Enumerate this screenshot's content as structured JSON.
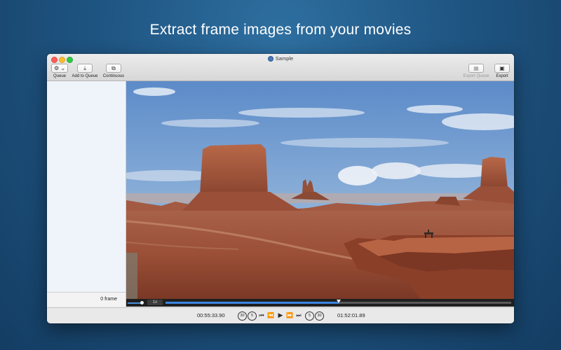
{
  "headline": "Extract frame images from your movies",
  "window": {
    "title": "Sample"
  },
  "toolbar": {
    "queue_icon": "⚙ ⌄",
    "queue_label": "Queue",
    "add_icon": "⤓",
    "add_label": "Add to Queue",
    "continuous_icon": "⧉",
    "continuous_label": "Continuous",
    "export_queue_icon": "▦",
    "export_queue_label": "Export Queue",
    "export_icon": "▣",
    "export_label": "Export"
  },
  "sidebar": {
    "frame_count": "0 frame"
  },
  "player": {
    "speed": "1x",
    "progress": 0.5,
    "current_time": "00:55:33.90",
    "total_time": "01:52:01.89",
    "back30": "30",
    "back5": "5",
    "fwd5": "5",
    "fwd30": "30",
    "prev_glyph": "⏮",
    "rewind_glyph": "⏪",
    "play_glyph": "▶",
    "forward_glyph": "⏩",
    "next_glyph": "⏭"
  },
  "colors": {
    "accent": "#3a86e0",
    "background": "#1f5582"
  }
}
